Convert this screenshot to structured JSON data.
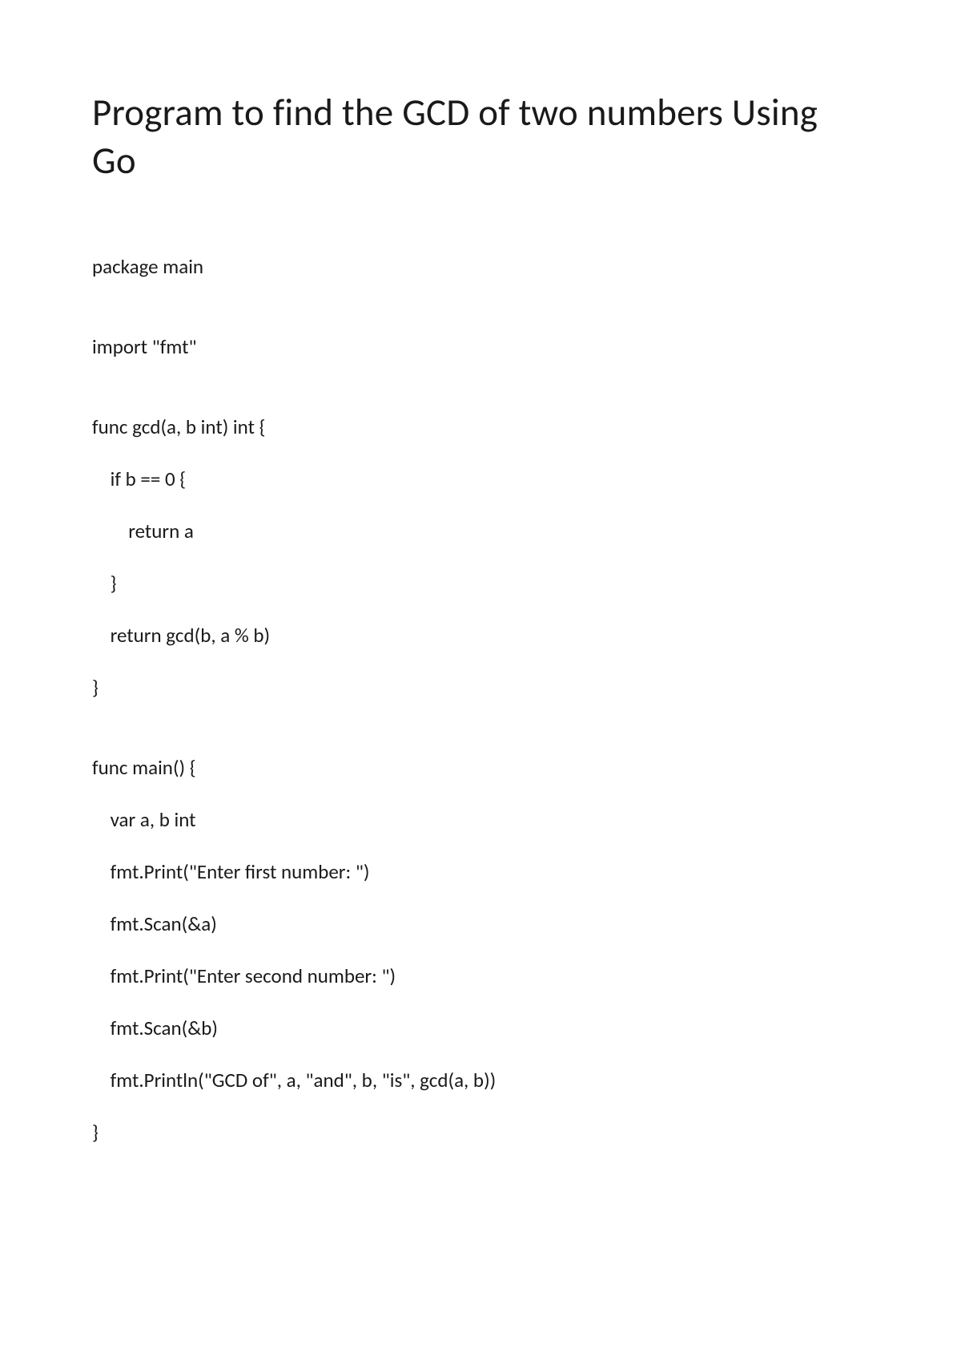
{
  "title": "Program to find the GCD of two numbers Using Go",
  "code": {
    "line1": "package main",
    "line2": "import \"fmt\"",
    "line3": "func gcd(a, b int) int {",
    "line4": "    if b == 0 {",
    "line5": "        return a",
    "line6": "    }",
    "line7": "    return gcd(b, a % b)",
    "line8": "}",
    "line9": "func main() {",
    "line10": "    var a, b int",
    "line11": "    fmt.Print(\"Enter first number: \")",
    "line12": "    fmt.Scan(&a)",
    "line13": "    fmt.Print(\"Enter second number: \")",
    "line14": "    fmt.Scan(&b)",
    "line15": "    fmt.Println(\"GCD of\", a, \"and\", b, \"is\", gcd(a, b))",
    "line16": "}"
  }
}
